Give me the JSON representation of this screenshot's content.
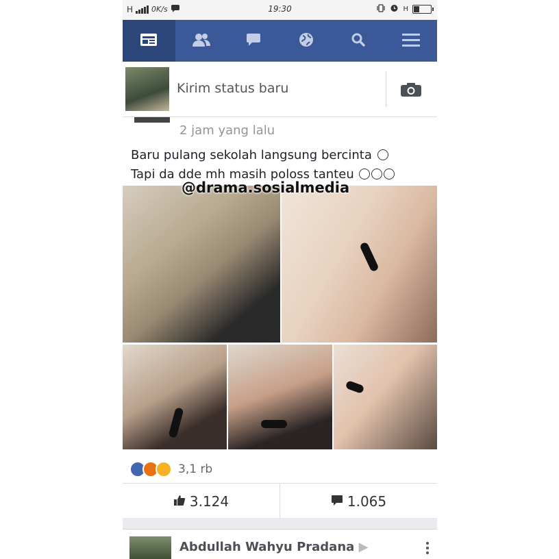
{
  "status_bar": {
    "network": "H",
    "speed": "0K/s",
    "time": "19:30",
    "right_network": "H"
  },
  "nav": {
    "tabs": [
      {
        "icon": "news-feed-icon",
        "active": true
      },
      {
        "icon": "friends-icon",
        "active": false
      },
      {
        "icon": "messages-icon",
        "active": false
      },
      {
        "icon": "globe-icon",
        "active": false
      },
      {
        "icon": "search-icon",
        "active": false
      },
      {
        "icon": "menu-icon",
        "active": false
      }
    ],
    "color": "#3b5998"
  },
  "composer": {
    "placeholder": "Kirim status baru"
  },
  "post": {
    "time": "2 jam yang lalu",
    "line1": "Baru pulang sekolah langsung bercinta",
    "line2": "Tapi da dde mh masih poloss tanteu",
    "watermark": "@drama.sosialmedia",
    "reaction_count": "3,1 rb",
    "likes": "3.124",
    "comments": "1.065"
  },
  "next_post": {
    "author": "Abdullah Wahyu Pradana"
  }
}
